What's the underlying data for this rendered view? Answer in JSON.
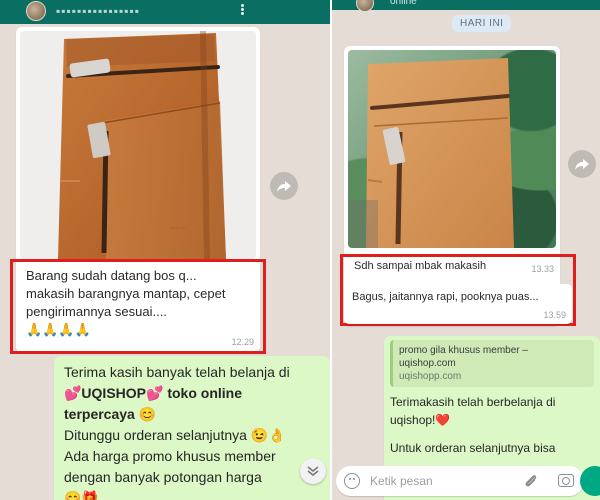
{
  "left": {
    "contact_name": "▪▪▪▪▪▪▪▪▪▪▪▪▪▪▪▪",
    "photo_caption": {
      "line1": "Barang sudah datang bos q...",
      "line2": "makasih barangnya mantap, cepet",
      "line3": "pengirimannya sesuai....",
      "line4": "🙏🙏🙏🙏",
      "time": "12.29"
    },
    "reply": {
      "line1": "Terima kasih banyak telah belanja di",
      "brand": "💕UQISHOP💕",
      "brand_suffix": " toko online",
      "line3": "terpercaya 😊",
      "line4": "Ditunggu orderan selanjutnya 😉👌",
      "line5": "Ada harga promo khusus member",
      "line6": "dengan banyak potongan harga",
      "line7": "😊🎁"
    }
  },
  "right": {
    "status": "online",
    "date_chip": "HARI INI",
    "msg1": {
      "text": "Sdh sampai mbak makasih",
      "time": "13.33"
    },
    "msg2": {
      "text": "Bagus, jaitannya rapi, pooknya puas...",
      "time": "13.59"
    },
    "link_preview": {
      "title": "promo gila khusus member –",
      "domain": "uqishop.com",
      "url": "uqishopp.com"
    },
    "reply": {
      "line1": "Terimakasih telah berbelanja di",
      "line2": "uqishop!❤️",
      "line3": "Untuk orderan selanjutnya bisa"
    },
    "input_placeholder": "Ketik pesan"
  },
  "colors": {
    "chat_bg": "#e5ddd5",
    "outgoing_bubble": "#dcf8c6",
    "highlight": "#e01e1e",
    "header": "#0b6e63"
  },
  "icons": [
    "forward-icon",
    "emoji-icon",
    "attach-icon",
    "camera-icon",
    "mic-icon",
    "chevron-down-icon",
    "menu-dots-icon"
  ]
}
